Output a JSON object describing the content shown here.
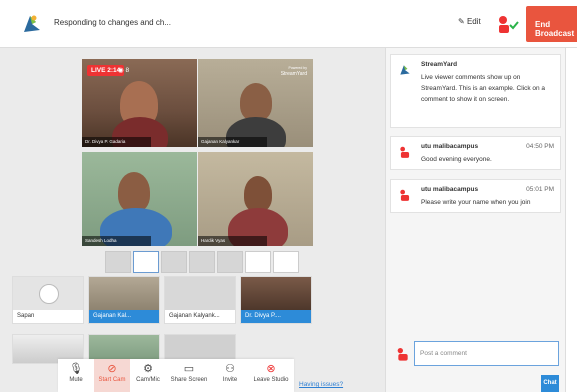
{
  "header": {
    "title": "Responding to changes and ch...",
    "edit_label": "Edit",
    "end_broadcast_label": "End Broadcast"
  },
  "stage": {
    "live_label": "LIVE 2:14",
    "viewers": "8",
    "badge_top": "Powered by",
    "badge_brand": "StreamYard",
    "participants": [
      {
        "name": "Dr. Divya P. Gadaria"
      },
      {
        "name": "Gajanan Kalyankar"
      },
      {
        "name": "Sandesh Lodha"
      },
      {
        "name": "Hardik Vyas"
      }
    ]
  },
  "thumbnails": [
    {
      "name": "Sapan",
      "on_stage": false
    },
    {
      "name": "Gajanan Kal...",
      "on_stage": true
    },
    {
      "name": "Gajanan Kalyank...",
      "on_stage": false
    },
    {
      "name": "Dr. Divya P....",
      "on_stage": true
    }
  ],
  "controls": [
    {
      "label": "Mute",
      "icon": "microphone-icon"
    },
    {
      "label": "Start Cam",
      "icon": "camera-off-icon"
    },
    {
      "label": "Cam/Mic",
      "icon": "gear-icon"
    },
    {
      "label": "Share Screen",
      "icon": "monitor-icon"
    },
    {
      "label": "Invite",
      "icon": "add-user-icon"
    },
    {
      "label": "Leave Studio",
      "icon": "close-icon"
    }
  ],
  "trouble_link": "Having issues?",
  "chat": {
    "messages": [
      {
        "author": "StreamYard",
        "time": "",
        "text": "Live viewer comments show up on StreamYard. This is an example. Click on a comment to show it on screen."
      },
      {
        "author": "utu malibacampus",
        "time": "04:50 PM",
        "text": "Good evening everyone."
      },
      {
        "author": "utu malibacampus",
        "time": "05:01 PM",
        "text": "Please write your name when you join"
      }
    ],
    "input_placeholder": "Post a comment",
    "send_label": "Chat"
  },
  "colors": {
    "accent": "#e9553e",
    "link": "#2d8bd8",
    "live": "#e33333"
  }
}
